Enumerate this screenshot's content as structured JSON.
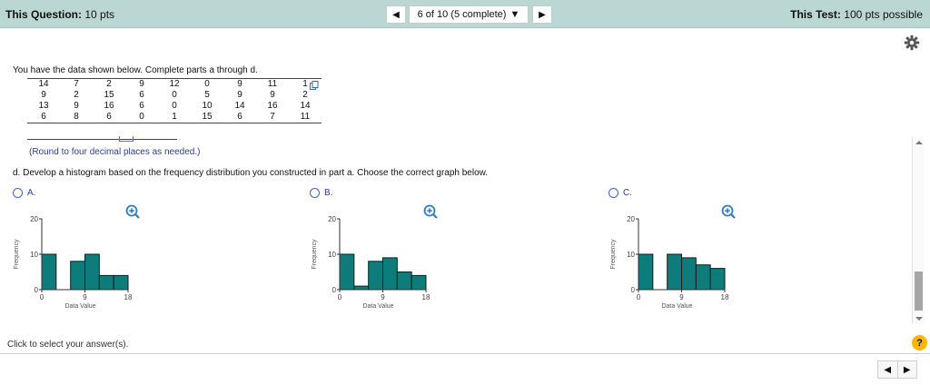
{
  "header": {
    "question_label": "This Question:",
    "question_value": "10 pts",
    "progress_text": "6 of 10 (5 complete)",
    "test_label": "This Test:",
    "test_value": "100 pts possible",
    "prev_icon": "triangle-left-icon",
    "next_icon": "triangle-right-icon",
    "dropdown_icon": "triangle-down-icon"
  },
  "question": {
    "prompt": "You have the data shown below. Complete parts a through d.",
    "data_rows": [
      [
        "14",
        "7",
        "2",
        "9",
        "12",
        "0",
        "9",
        "11",
        "1"
      ],
      [
        "9",
        "2",
        "15",
        "6",
        "0",
        "5",
        "9",
        "9",
        "2"
      ],
      [
        "13",
        "9",
        "16",
        "6",
        "0",
        "10",
        "14",
        "16",
        "14"
      ],
      [
        "6",
        "8",
        "6",
        "0",
        "1",
        "15",
        "6",
        "7",
        "11"
      ]
    ],
    "round_note": "(Round to four decimal places as needed.)",
    "part_d": "d. Develop a histogram based on the frequency distribution you constructed in part a. Choose the correct graph below."
  },
  "options": [
    {
      "letter": "A."
    },
    {
      "letter": "B."
    },
    {
      "letter": "C."
    }
  ],
  "chart_data": [
    {
      "type": "bar",
      "ylabel": "Frequency",
      "xlabel": "Data Value",
      "xticks": [
        "0",
        "9",
        "18"
      ],
      "yticks": [
        "0",
        "10",
        "20"
      ],
      "ylim": [
        0,
        20
      ],
      "xlim": [
        0,
        18
      ],
      "bins": [
        [
          0,
          3
        ],
        [
          3,
          6
        ],
        [
          6,
          9
        ],
        [
          9,
          12
        ],
        [
          12,
          15
        ],
        [
          15,
          18
        ]
      ],
      "values": [
        10,
        0,
        8,
        10,
        4,
        4
      ]
    },
    {
      "type": "bar",
      "ylabel": "Frequency",
      "xlabel": "Data Value",
      "xticks": [
        "0",
        "9",
        "18"
      ],
      "yticks": [
        "0",
        "10",
        "20"
      ],
      "ylim": [
        0,
        20
      ],
      "xlim": [
        0,
        18
      ],
      "bins": [
        [
          0,
          3
        ],
        [
          3,
          6
        ],
        [
          6,
          9
        ],
        [
          9,
          12
        ],
        [
          12,
          15
        ],
        [
          15,
          18
        ]
      ],
      "values": [
        10,
        1,
        8,
        9,
        5,
        4
      ]
    },
    {
      "type": "bar",
      "ylabel": "Frequency",
      "xlabel": "Data Value",
      "xticks": [
        "0",
        "9",
        "18"
      ],
      "yticks": [
        "0",
        "10",
        "20"
      ],
      "ylim": [
        0,
        20
      ],
      "xlim": [
        0,
        18
      ],
      "bins": [
        [
          0,
          3
        ],
        [
          3,
          6
        ],
        [
          6,
          9
        ],
        [
          9,
          12
        ],
        [
          12,
          15
        ],
        [
          15,
          18
        ]
      ],
      "values": [
        10,
        0,
        10,
        9,
        7,
        6
      ]
    }
  ],
  "colors": {
    "header_bg": "#bad7d3",
    "bar_fill": "#0e7c7b",
    "bar_stroke": "#1a1a1a",
    "link": "#2a3f8f",
    "help_bg": "#f5b800"
  },
  "footer": {
    "click_note": "Click to select your answer(s).",
    "help_label": "?",
    "prev_icon": "triangle-left-icon",
    "next_icon": "triangle-right-icon"
  }
}
